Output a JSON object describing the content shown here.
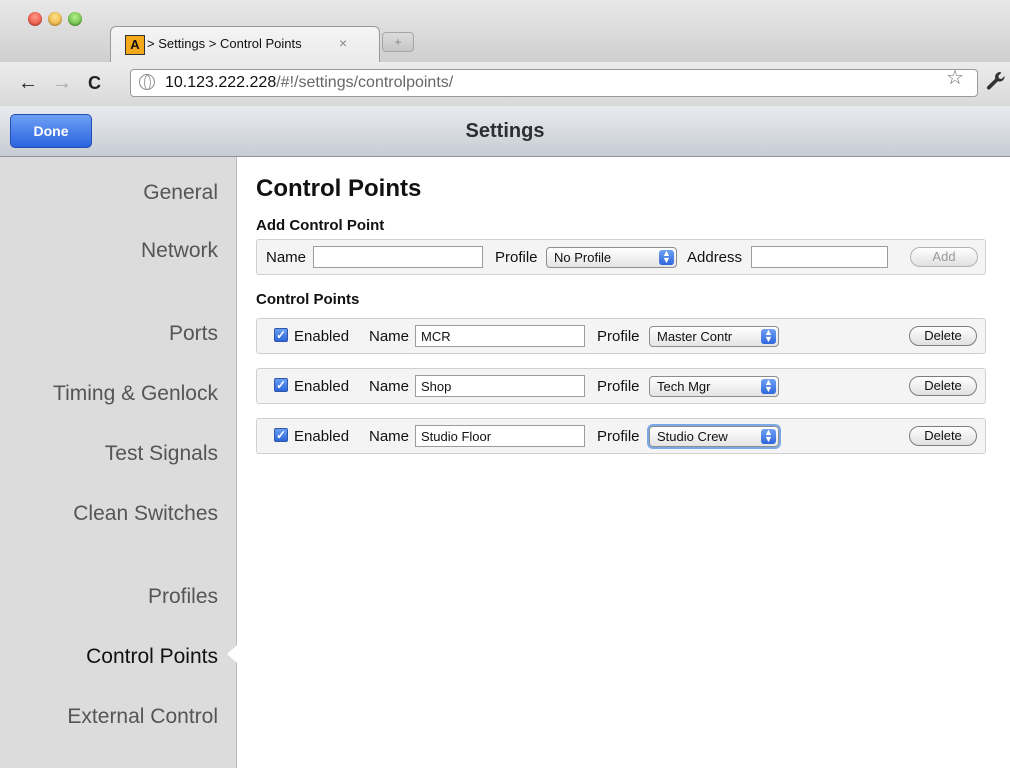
{
  "browser": {
    "tab_favicon_letter": "A",
    "tab_title": "> Settings > Control Points",
    "tab_close": "×",
    "new_tab": "+",
    "back": "←",
    "forward": "→",
    "reload": "C",
    "url_host": "10.123.222.228",
    "url_path": "/#!/settings/controlpoints/",
    "bookmark_star": "☆",
    "wrench": "🔧"
  },
  "header": {
    "done_label": "Done",
    "title": "Settings"
  },
  "sidebar": {
    "items": [
      {
        "label": "General"
      },
      {
        "label": "Network"
      },
      {
        "label": "Ports"
      },
      {
        "label": "Timing & Genlock"
      },
      {
        "label": "Test Signals"
      },
      {
        "label": "Clean Switches"
      },
      {
        "label": "Profiles"
      },
      {
        "label": "Control Points"
      },
      {
        "label": "External Control"
      }
    ],
    "active": "Control Points"
  },
  "main": {
    "heading": "Control Points",
    "add_section": {
      "title": "Add Control Point",
      "name_label": "Name",
      "name_value": "",
      "profile_label": "Profile",
      "profile_value": "No Profile",
      "address_label": "Address",
      "address_value": "",
      "add_button": "Add"
    },
    "list_section": {
      "title": "Control Points",
      "enabled_label": "Enabled",
      "name_label": "Name",
      "profile_label": "Profile",
      "delete_label": "Delete",
      "items": [
        {
          "enabled": true,
          "name": "MCR",
          "profile": "Master Contr"
        },
        {
          "enabled": true,
          "name": "Shop",
          "profile": "Tech Mgr"
        },
        {
          "enabled": true,
          "name": "Studio Floor",
          "profile": "Studio Crew"
        }
      ]
    }
  },
  "colors": {
    "accent": "#2b63df",
    "sidebar_bg": "#dcdcdc",
    "row_bg": "#f4f4f4"
  }
}
